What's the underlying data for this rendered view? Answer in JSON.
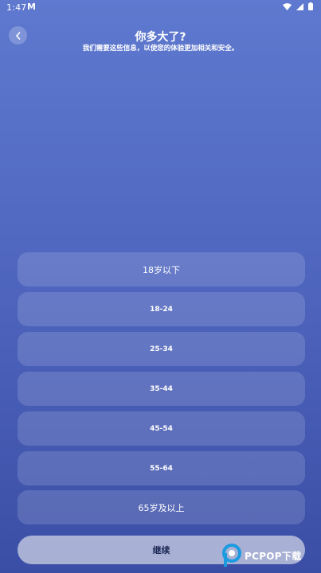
{
  "status_bar": {
    "time": "1:47",
    "notification": "M"
  },
  "header": {
    "title": "你多大了?",
    "subtitle": "我们需要这些信息，以使您的体验更加相关和安全。"
  },
  "options": [
    {
      "label": "18岁以下"
    },
    {
      "label": "18-24"
    },
    {
      "label": "25-34"
    },
    {
      "label": "35-44"
    },
    {
      "label": "45-54"
    },
    {
      "label": "55-64"
    },
    {
      "label": "65岁及以上"
    }
  ],
  "continue_label": "继续",
  "watermark": {
    "text": "PCPOP下载"
  },
  "colors": {
    "gradient_top": "#5e79cf",
    "gradient_bottom": "#3b4ea6",
    "watermark_accent": "#1c9be0"
  }
}
